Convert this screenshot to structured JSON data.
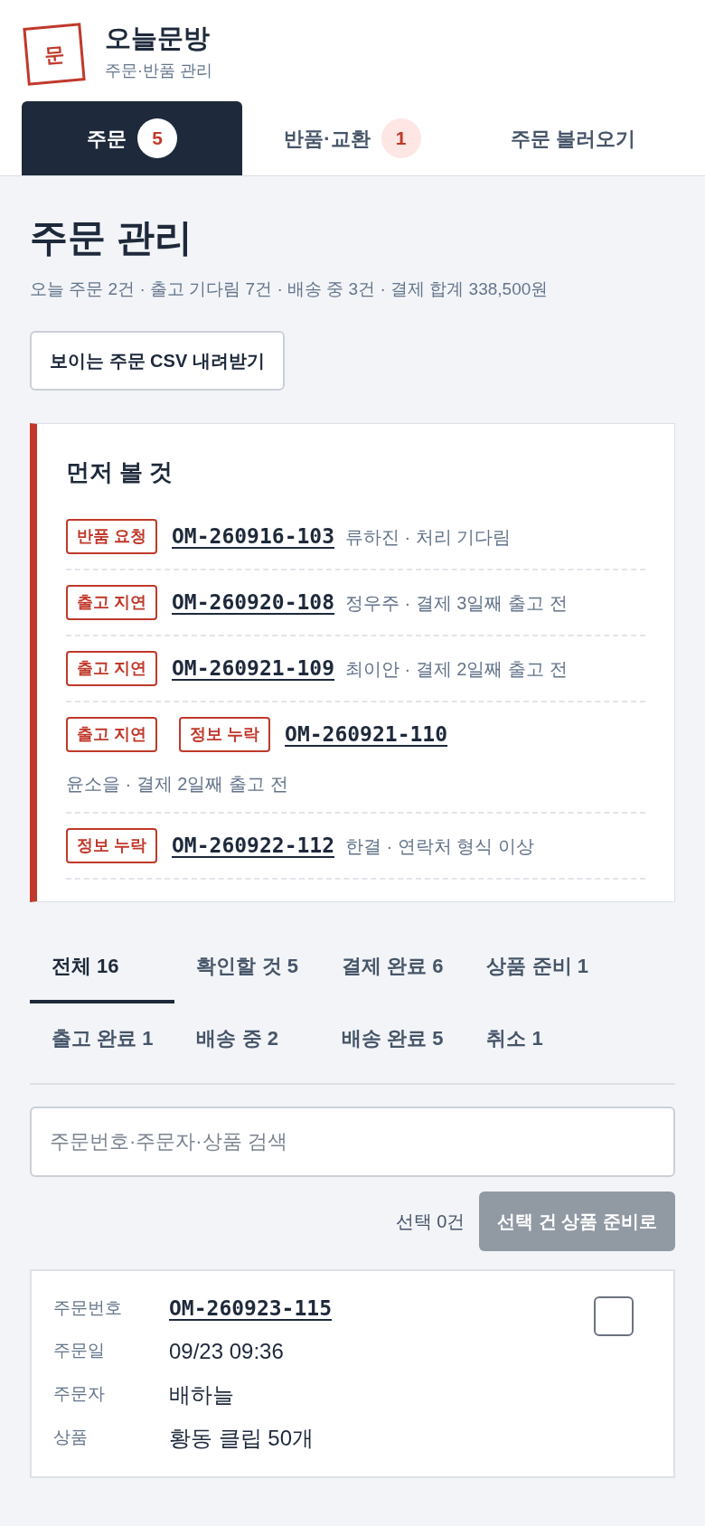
{
  "brand": {
    "logo": "문",
    "name": "오늘문방",
    "subtitle": "주문·반품 관리"
  },
  "main_tabs": [
    {
      "label": "주문",
      "count": "5",
      "selected": true
    },
    {
      "label": "반품·교환",
      "count": "1",
      "selected": false
    },
    {
      "label": "주문 불러오기",
      "selected": false
    }
  ],
  "page": {
    "title": "주문 관리",
    "summary": "오늘 주문 2건 · 출고 기다림 7건 · 배송 중 3건 · 결제 합계 338,500원",
    "csv_button": "보이는 주문 CSV 내려받기"
  },
  "priority": {
    "title": "먼저 볼 것",
    "items": [
      {
        "tags": [
          "반품 요청"
        ],
        "order": "OM-260916-103",
        "note": "류하진 · 처리 기다림"
      },
      {
        "tags": [
          "출고 지연"
        ],
        "order": "OM-260920-108",
        "note": "정우주 · 결제 3일째 출고 전"
      },
      {
        "tags": [
          "출고 지연"
        ],
        "order": "OM-260921-109",
        "note": "최이안 · 결제 2일째 출고 전"
      },
      {
        "tags": [
          "출고 지연",
          "정보 누락"
        ],
        "order": "OM-260921-110",
        "note": "윤소을 · 결제 2일째 출고 전"
      },
      {
        "tags": [
          "정보 누락"
        ],
        "order": "OM-260922-112",
        "note": "한결 · 연락처 형식 이상"
      }
    ]
  },
  "filters": [
    {
      "label": "전체 16",
      "selected": true
    },
    {
      "label": "확인할 것 5",
      "selected": false
    },
    {
      "label": "결제 완료 6",
      "selected": false
    },
    {
      "label": "상품 준비 1",
      "selected": false
    },
    {
      "label": "출고 완료 1",
      "selected": false
    },
    {
      "label": "배송 중 2",
      "selected": false
    },
    {
      "label": "배송 완료 5",
      "selected": false
    },
    {
      "label": "취소 1",
      "selected": false
    }
  ],
  "search": {
    "placeholder": "주문번호·주문자·상품 검색"
  },
  "selection": {
    "count": "선택 0건",
    "button": "선택 건 상품 준비로",
    "disabled": true
  },
  "orders": [
    {
      "checked": false,
      "fields": [
        {
          "kind": "link",
          "label": "주문번호",
          "value": "OM-260923-115"
        },
        {
          "kind": "text",
          "label": "주문일",
          "value": "09/23 09:36"
        },
        {
          "kind": "text",
          "label": "주문자",
          "value": "배하늘"
        },
        {
          "kind": "text",
          "label": "상품",
          "value": "황동 클립 50개"
        }
      ]
    }
  ]
}
